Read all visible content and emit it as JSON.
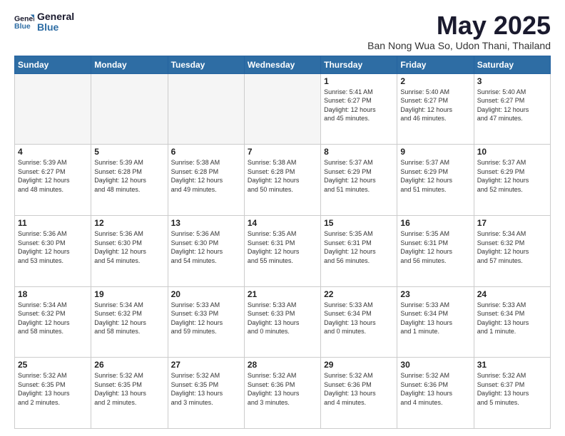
{
  "logo": {
    "line1": "General",
    "line2": "Blue"
  },
  "title": "May 2025",
  "subtitle": "Ban Nong Wua So, Udon Thani, Thailand",
  "headers": [
    "Sunday",
    "Monday",
    "Tuesday",
    "Wednesday",
    "Thursday",
    "Friday",
    "Saturday"
  ],
  "weeks": [
    [
      {
        "day": "",
        "info": ""
      },
      {
        "day": "",
        "info": ""
      },
      {
        "day": "",
        "info": ""
      },
      {
        "day": "",
        "info": ""
      },
      {
        "day": "1",
        "info": "Sunrise: 5:41 AM\nSunset: 6:27 PM\nDaylight: 12 hours\nand 45 minutes."
      },
      {
        "day": "2",
        "info": "Sunrise: 5:40 AM\nSunset: 6:27 PM\nDaylight: 12 hours\nand 46 minutes."
      },
      {
        "day": "3",
        "info": "Sunrise: 5:40 AM\nSunset: 6:27 PM\nDaylight: 12 hours\nand 47 minutes."
      }
    ],
    [
      {
        "day": "4",
        "info": "Sunrise: 5:39 AM\nSunset: 6:27 PM\nDaylight: 12 hours\nand 48 minutes."
      },
      {
        "day": "5",
        "info": "Sunrise: 5:39 AM\nSunset: 6:28 PM\nDaylight: 12 hours\nand 48 minutes."
      },
      {
        "day": "6",
        "info": "Sunrise: 5:38 AM\nSunset: 6:28 PM\nDaylight: 12 hours\nand 49 minutes."
      },
      {
        "day": "7",
        "info": "Sunrise: 5:38 AM\nSunset: 6:28 PM\nDaylight: 12 hours\nand 50 minutes."
      },
      {
        "day": "8",
        "info": "Sunrise: 5:37 AM\nSunset: 6:29 PM\nDaylight: 12 hours\nand 51 minutes."
      },
      {
        "day": "9",
        "info": "Sunrise: 5:37 AM\nSunset: 6:29 PM\nDaylight: 12 hours\nand 51 minutes."
      },
      {
        "day": "10",
        "info": "Sunrise: 5:37 AM\nSunset: 6:29 PM\nDaylight: 12 hours\nand 52 minutes."
      }
    ],
    [
      {
        "day": "11",
        "info": "Sunrise: 5:36 AM\nSunset: 6:30 PM\nDaylight: 12 hours\nand 53 minutes."
      },
      {
        "day": "12",
        "info": "Sunrise: 5:36 AM\nSunset: 6:30 PM\nDaylight: 12 hours\nand 54 minutes."
      },
      {
        "day": "13",
        "info": "Sunrise: 5:36 AM\nSunset: 6:30 PM\nDaylight: 12 hours\nand 54 minutes."
      },
      {
        "day": "14",
        "info": "Sunrise: 5:35 AM\nSunset: 6:31 PM\nDaylight: 12 hours\nand 55 minutes."
      },
      {
        "day": "15",
        "info": "Sunrise: 5:35 AM\nSunset: 6:31 PM\nDaylight: 12 hours\nand 56 minutes."
      },
      {
        "day": "16",
        "info": "Sunrise: 5:35 AM\nSunset: 6:31 PM\nDaylight: 12 hours\nand 56 minutes."
      },
      {
        "day": "17",
        "info": "Sunrise: 5:34 AM\nSunset: 6:32 PM\nDaylight: 12 hours\nand 57 minutes."
      }
    ],
    [
      {
        "day": "18",
        "info": "Sunrise: 5:34 AM\nSunset: 6:32 PM\nDaylight: 12 hours\nand 58 minutes."
      },
      {
        "day": "19",
        "info": "Sunrise: 5:34 AM\nSunset: 6:32 PM\nDaylight: 12 hours\nand 58 minutes."
      },
      {
        "day": "20",
        "info": "Sunrise: 5:33 AM\nSunset: 6:33 PM\nDaylight: 12 hours\nand 59 minutes."
      },
      {
        "day": "21",
        "info": "Sunrise: 5:33 AM\nSunset: 6:33 PM\nDaylight: 13 hours\nand 0 minutes."
      },
      {
        "day": "22",
        "info": "Sunrise: 5:33 AM\nSunset: 6:34 PM\nDaylight: 13 hours\nand 0 minutes."
      },
      {
        "day": "23",
        "info": "Sunrise: 5:33 AM\nSunset: 6:34 PM\nDaylight: 13 hours\nand 1 minute."
      },
      {
        "day": "24",
        "info": "Sunrise: 5:33 AM\nSunset: 6:34 PM\nDaylight: 13 hours\nand 1 minute."
      }
    ],
    [
      {
        "day": "25",
        "info": "Sunrise: 5:32 AM\nSunset: 6:35 PM\nDaylight: 13 hours\nand 2 minutes."
      },
      {
        "day": "26",
        "info": "Sunrise: 5:32 AM\nSunset: 6:35 PM\nDaylight: 13 hours\nand 2 minutes."
      },
      {
        "day": "27",
        "info": "Sunrise: 5:32 AM\nSunset: 6:35 PM\nDaylight: 13 hours\nand 3 minutes."
      },
      {
        "day": "28",
        "info": "Sunrise: 5:32 AM\nSunset: 6:36 PM\nDaylight: 13 hours\nand 3 minutes."
      },
      {
        "day": "29",
        "info": "Sunrise: 5:32 AM\nSunset: 6:36 PM\nDaylight: 13 hours\nand 4 minutes."
      },
      {
        "day": "30",
        "info": "Sunrise: 5:32 AM\nSunset: 6:36 PM\nDaylight: 13 hours\nand 4 minutes."
      },
      {
        "day": "31",
        "info": "Sunrise: 5:32 AM\nSunset: 6:37 PM\nDaylight: 13 hours\nand 5 minutes."
      }
    ]
  ]
}
